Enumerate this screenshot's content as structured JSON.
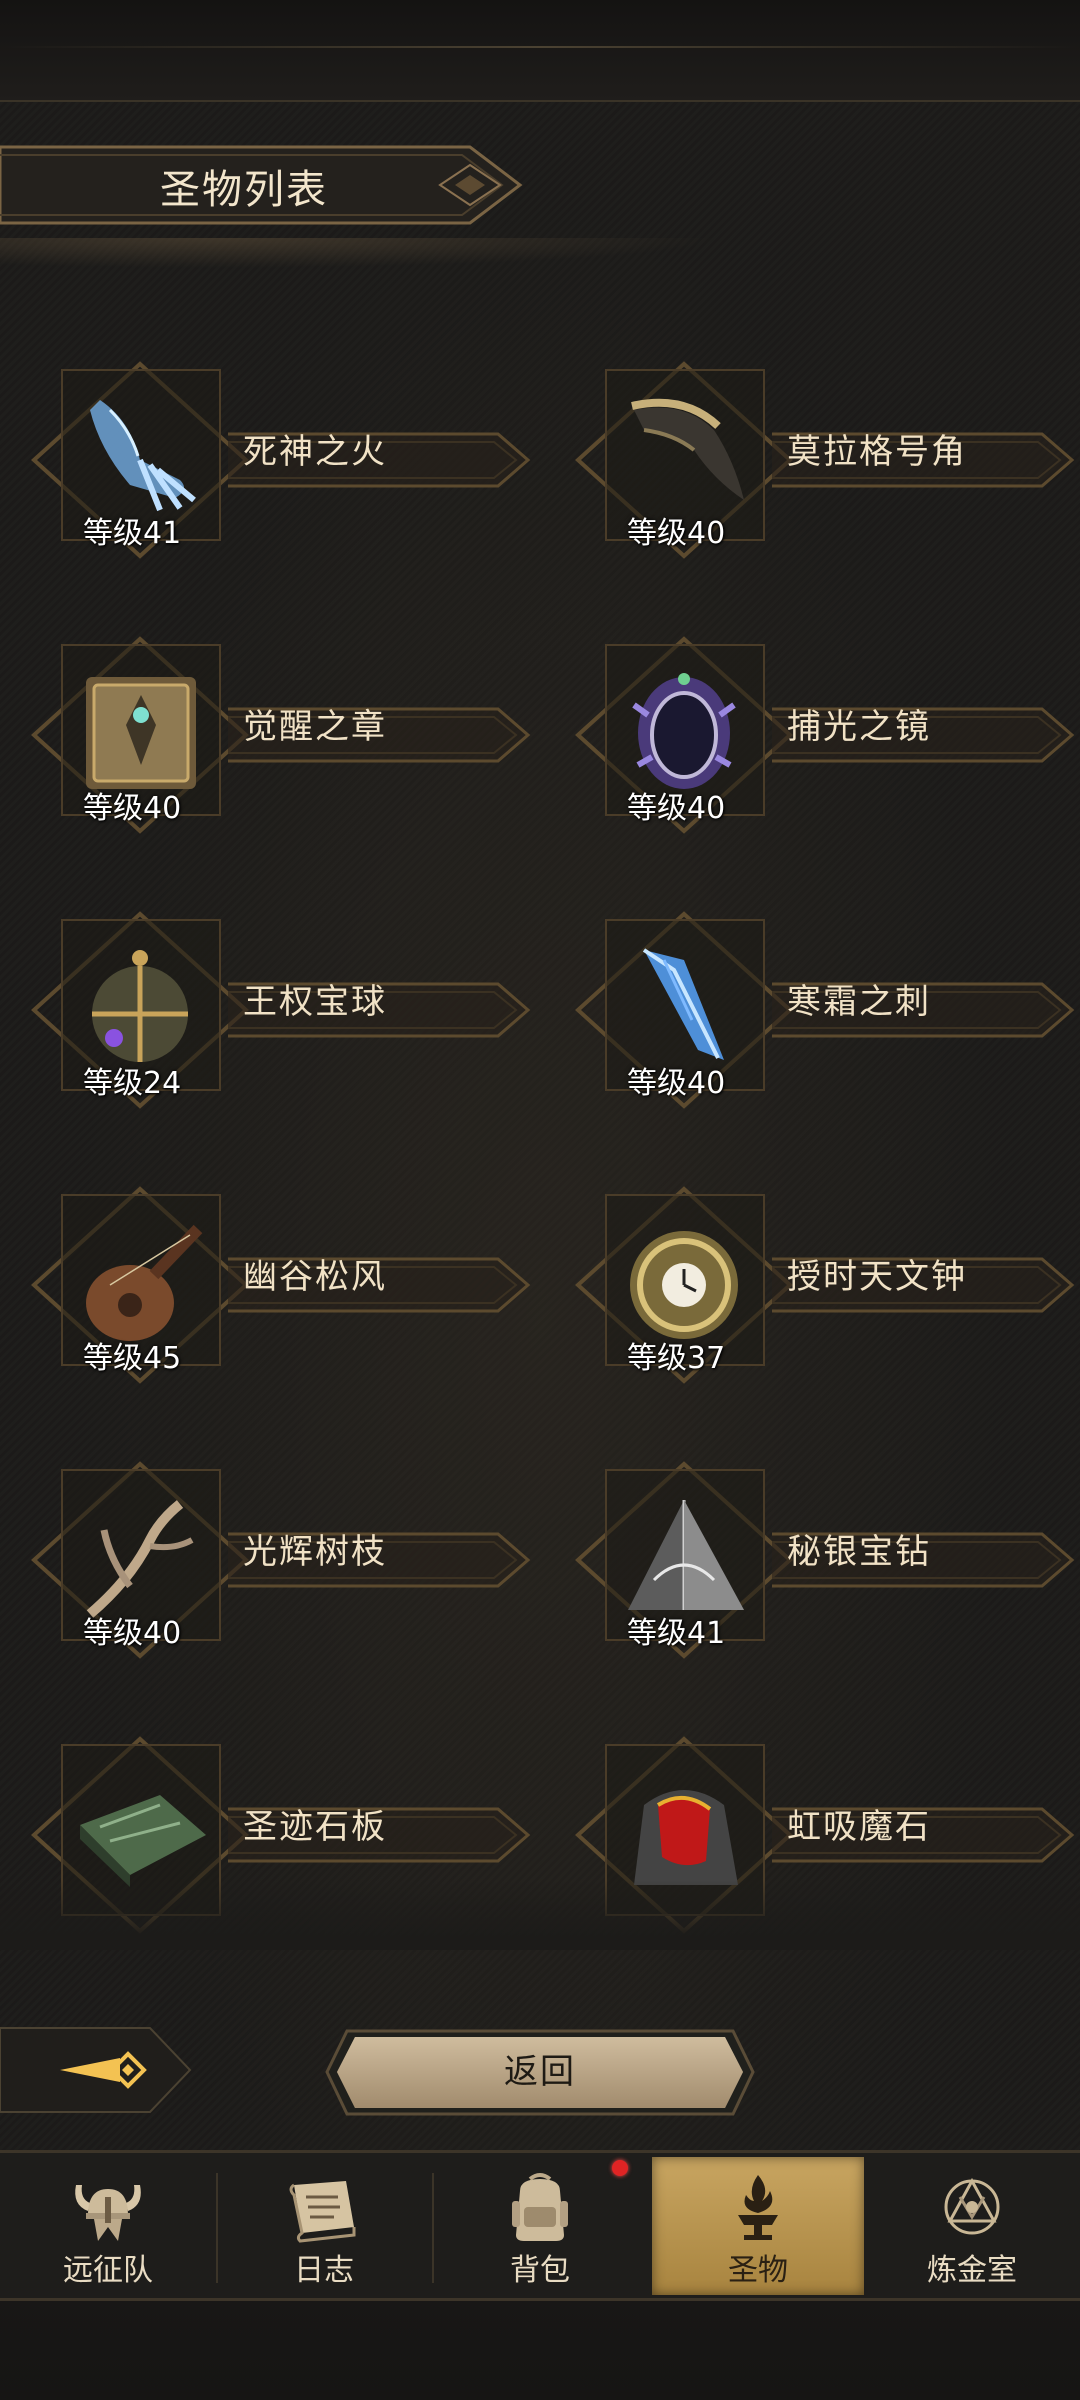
{
  "header": {
    "title": "圣物列表"
  },
  "relics": [
    {
      "name": "死神之火",
      "level": "等级41",
      "icon": "blue-spectral-hand-icon"
    },
    {
      "name": "莫拉格号角",
      "level": "等级40",
      "icon": "horn-icon"
    },
    {
      "name": "觉醒之章",
      "level": "等级40",
      "icon": "ancient-book-icon"
    },
    {
      "name": "捕光之镜",
      "level": "等级40",
      "icon": "crystal-mirror-icon"
    },
    {
      "name": "王权宝球",
      "level": "等级24",
      "icon": "royal-orb-icon"
    },
    {
      "name": "寒霜之刺",
      "level": "等级40",
      "icon": "ice-shard-icon"
    },
    {
      "name": "幽谷松风",
      "level": "等级45",
      "icon": "lute-icon"
    },
    {
      "name": "授时天文钟",
      "level": "等级37",
      "icon": "astronomical-clock-icon"
    },
    {
      "name": "光辉树枝",
      "level": "等级40",
      "icon": "branch-icon"
    },
    {
      "name": "秘银宝钻",
      "level": "等级41",
      "icon": "mithril-pyramid-icon"
    },
    {
      "name": "圣迹石板",
      "level": "",
      "icon": "stone-tablet-icon"
    },
    {
      "name": "虹吸魔石",
      "level": "",
      "icon": "siphon-stone-icon"
    }
  ],
  "controls": {
    "back_label": "返回"
  },
  "nav": {
    "tabs": [
      {
        "label": "远征队",
        "icon": "viking-helmet-icon",
        "active": false
      },
      {
        "label": "日志",
        "icon": "scroll-icon",
        "active": false
      },
      {
        "label": "背包",
        "icon": "backpack-icon",
        "active": false
      },
      {
        "label": "圣物",
        "icon": "brazier-icon",
        "active": true
      },
      {
        "label": "炼金室",
        "icon": "alchemy-icon",
        "active": false
      }
    ]
  },
  "colors": {
    "accent_gold": "#c8a561",
    "frame_gold": "#6b5637",
    "background": "#1c1b19",
    "notification": "#e02424"
  }
}
